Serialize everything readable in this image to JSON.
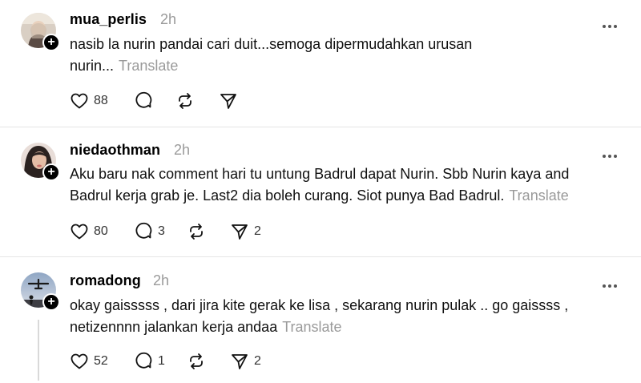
{
  "posts": [
    {
      "username": "mua_perlis",
      "time": "2h",
      "text_lines": [
        "nasib la nurin pandai cari duit...semoga dipermudahkan urusan",
        "nurin..."
      ],
      "translate": "Translate",
      "likes": "88",
      "replies": "",
      "shares": ""
    },
    {
      "username": "niedaothman",
      "time": "2h",
      "text_lines": [
        "Aku baru nak comment hari tu untung Badrul dapat Nurin. Sbb Nurin kaya and",
        "Badrul kerja grab je. Last2 dia boleh curang. Siot punya Bad Badrul."
      ],
      "translate": "Translate",
      "likes": "80",
      "replies": "3",
      "shares": "2"
    },
    {
      "username": "romadong",
      "time": "2h",
      "text_lines": [
        "okay gaisssss , dari jira kite gerak ke lisa , sekarang nurin pulak .. go gaissss ,",
        "netizennnn jalankan kerja andaa"
      ],
      "translate": "Translate",
      "likes": "52",
      "replies": "1",
      "shares": "2"
    }
  ],
  "icons": {
    "like": "heart-icon",
    "reply": "speech-bubble-icon",
    "repost": "repost-icon",
    "share": "paper-plane-icon",
    "more": "more-dots-icon",
    "follow": "plus-icon"
  }
}
